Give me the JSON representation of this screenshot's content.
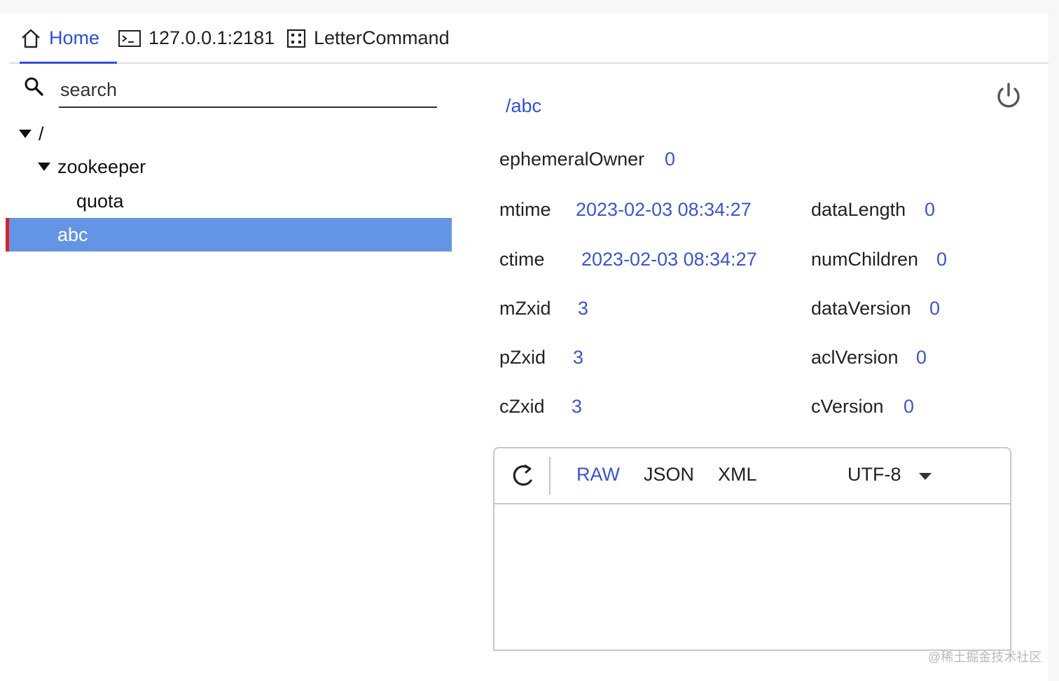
{
  "tabs": [
    {
      "label": "Home",
      "icon": "home-icon"
    },
    {
      "label": "127.0.0.1:2181",
      "icon": "terminal-icon"
    },
    {
      "label": "LetterCommand",
      "icon": "dice-icon"
    }
  ],
  "search": {
    "placeholder": "search",
    "value": "",
    "icon": "search-icon"
  },
  "tree": {
    "root": "/",
    "zookeeper": "zookeeper",
    "quota": "quota",
    "selected": "abc"
  },
  "node": {
    "path": "/abc",
    "ephemeralOwner": {
      "label": "ephemeralOwner",
      "value": "0"
    },
    "mtime": {
      "label": "mtime",
      "value": "2023-02-03 08:34:27"
    },
    "ctime": {
      "label": "ctime",
      "value": "2023-02-03 08:34:27"
    },
    "mZxid": {
      "label": "mZxid",
      "value": "3"
    },
    "pZxid": {
      "label": "pZxid",
      "value": "3"
    },
    "cZxid": {
      "label": "cZxid",
      "value": "3"
    },
    "dataLength": {
      "label": "dataLength",
      "value": "0"
    },
    "numChildren": {
      "label": "numChildren",
      "value": "0"
    },
    "dataVersion": {
      "label": "dataVersion",
      "value": "0"
    },
    "aclVersion": {
      "label": "aclVersion",
      "value": "0"
    },
    "cVersion": {
      "label": "cVersion",
      "value": "0"
    }
  },
  "viewer": {
    "formats": [
      "RAW",
      "JSON",
      "XML"
    ],
    "active_format": "RAW",
    "encoding": "UTF-8",
    "content": ""
  },
  "watermark": "@稀土掘金技术社区",
  "colors": {
    "accent": "#2f4fd6",
    "selected_bg": "#6495e5",
    "selected_marker": "#e01f2a",
    "value": "#3a56c8"
  }
}
